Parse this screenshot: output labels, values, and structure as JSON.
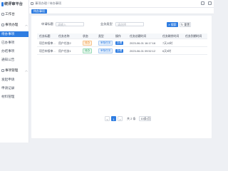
{
  "brand": {
    "title": "统评审平台"
  },
  "sidebar": {
    "items": [
      {
        "label": "工作台"
      },
      {
        "label": "事项办理"
      },
      {
        "label": "待办事项"
      },
      {
        "label": "已办事项"
      },
      {
        "label": "办结事项"
      },
      {
        "label": "通知公告"
      },
      {
        "label": "事项管理"
      },
      {
        "label": "发起申请"
      },
      {
        "label": "申请记录"
      },
      {
        "label": "材料管理"
      }
    ]
  },
  "topbar": {
    "breadcrumb_home": "事项办理",
    "breadcrumb_current": "待办事项"
  },
  "tabs": [
    {
      "label": "待办事项"
    }
  ],
  "filters": {
    "title_label": "申请标题",
    "title_placeholder": "请输入",
    "type_label": "业务类型",
    "type_placeholder": "请选择",
    "search_label": "搜索",
    "reset_label": "重置"
  },
  "table": {
    "columns": [
      "任务标题",
      "任务名称",
      "状态",
      "类型",
      "操作",
      "任务创建时间",
      "任务剩余时间",
      "任务到期时间"
    ],
    "rows": [
      {
        "title": "项目申报审...",
        "name": "用户任务2",
        "status": "待办",
        "type": "审核任务",
        "action": "办理",
        "created": "2023-06-01 16:17:16",
        "remaining": "7天10时",
        "due": ""
      },
      {
        "title": "项目申报审...",
        "name": "用户任务1",
        "status": "待办",
        "type": "审核任务",
        "action": "办理",
        "created": "2023-06-01 09:52:12",
        "remaining": "6天9时",
        "due": ""
      }
    ]
  },
  "pagination": {
    "prev": "<",
    "current": "1",
    "next": ">",
    "total_text": "共 2 条",
    "page_size": "10条/页"
  },
  "colors": {
    "accent": "#2f7de1"
  }
}
